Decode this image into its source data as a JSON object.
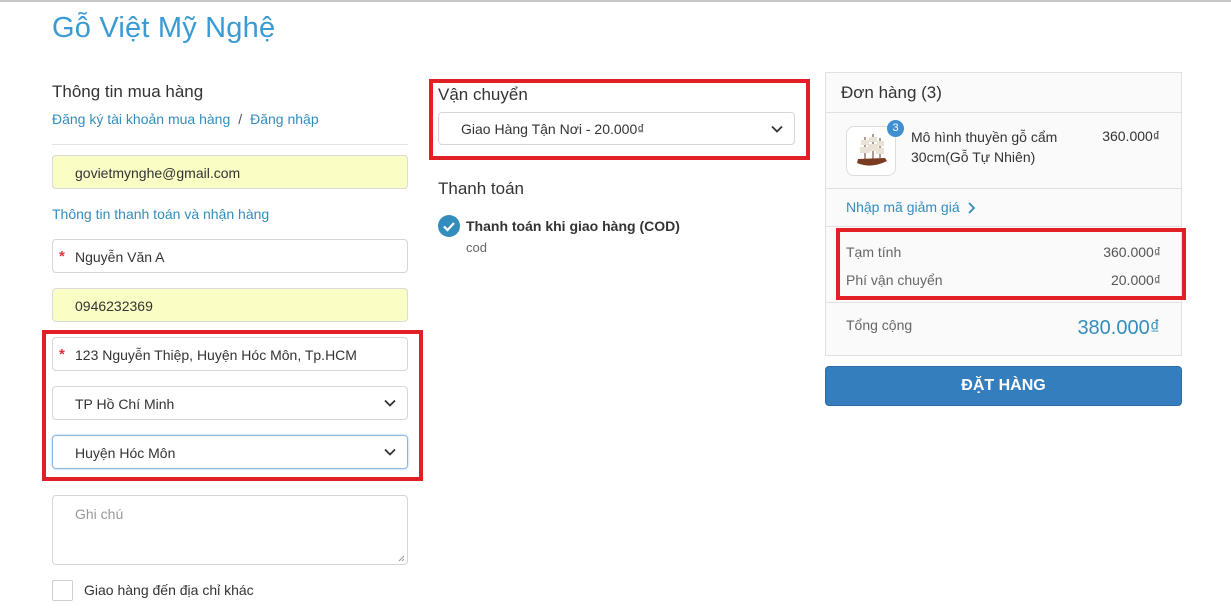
{
  "brand": "Gỗ Việt Mỹ Nghệ",
  "customer": {
    "title": "Thông tin mua hàng",
    "register_link": "Đăng ký tài khoản mua hàng",
    "separator": "/",
    "login_link": "Đăng nhập",
    "email": "govietmynghe@gmail.com",
    "billing_title": "Thông tin thanh toán và nhận hàng",
    "name": "Nguyễn Văn A",
    "phone": "0946232369",
    "address": "123 Nguyễn Thiệp, Huyện Hóc Môn, Tp.HCM",
    "province": "TP Hồ Chí Minh",
    "district": "Huyện Hóc Môn",
    "note_placeholder": "Ghi chú",
    "other_address_label": "Giao hàng đến địa chỉ khác",
    "required_mark": "*"
  },
  "shipping": {
    "title": "Vận chuyển",
    "selected": "Giao Hàng Tận Nơi - 20.000₫"
  },
  "payment": {
    "title": "Thanh toán",
    "method": "Thanh toán khi giao hàng (COD)",
    "method_sub": "cod"
  },
  "order": {
    "title": "Đơn hàng (3)",
    "item": {
      "name": "Mô hình thuyền gỗ cẩm 30cm(Gỗ Tự Nhiên)",
      "qty": "3",
      "price": "360.000₫"
    },
    "coupon_link": "Nhập mã giảm giá",
    "subtotal_label": "Tạm tính",
    "subtotal": "360.000₫",
    "shipping_fee_label": "Phí vận chuyển",
    "shipping_fee": "20.000₫",
    "total_label": "Tổng cộng",
    "total": "380.000₫",
    "place_order": "ĐẶT HÀNG"
  },
  "colors": {
    "brand": "#3a9ad4",
    "link": "#338dbc",
    "button": "#357ebd",
    "highlight_box": "#e01f26",
    "autofill": "#fafdc4"
  },
  "icons": [
    "chevron-down-icon",
    "check-circle-icon",
    "chevron-right-icon",
    "ship-thumbnail"
  ]
}
